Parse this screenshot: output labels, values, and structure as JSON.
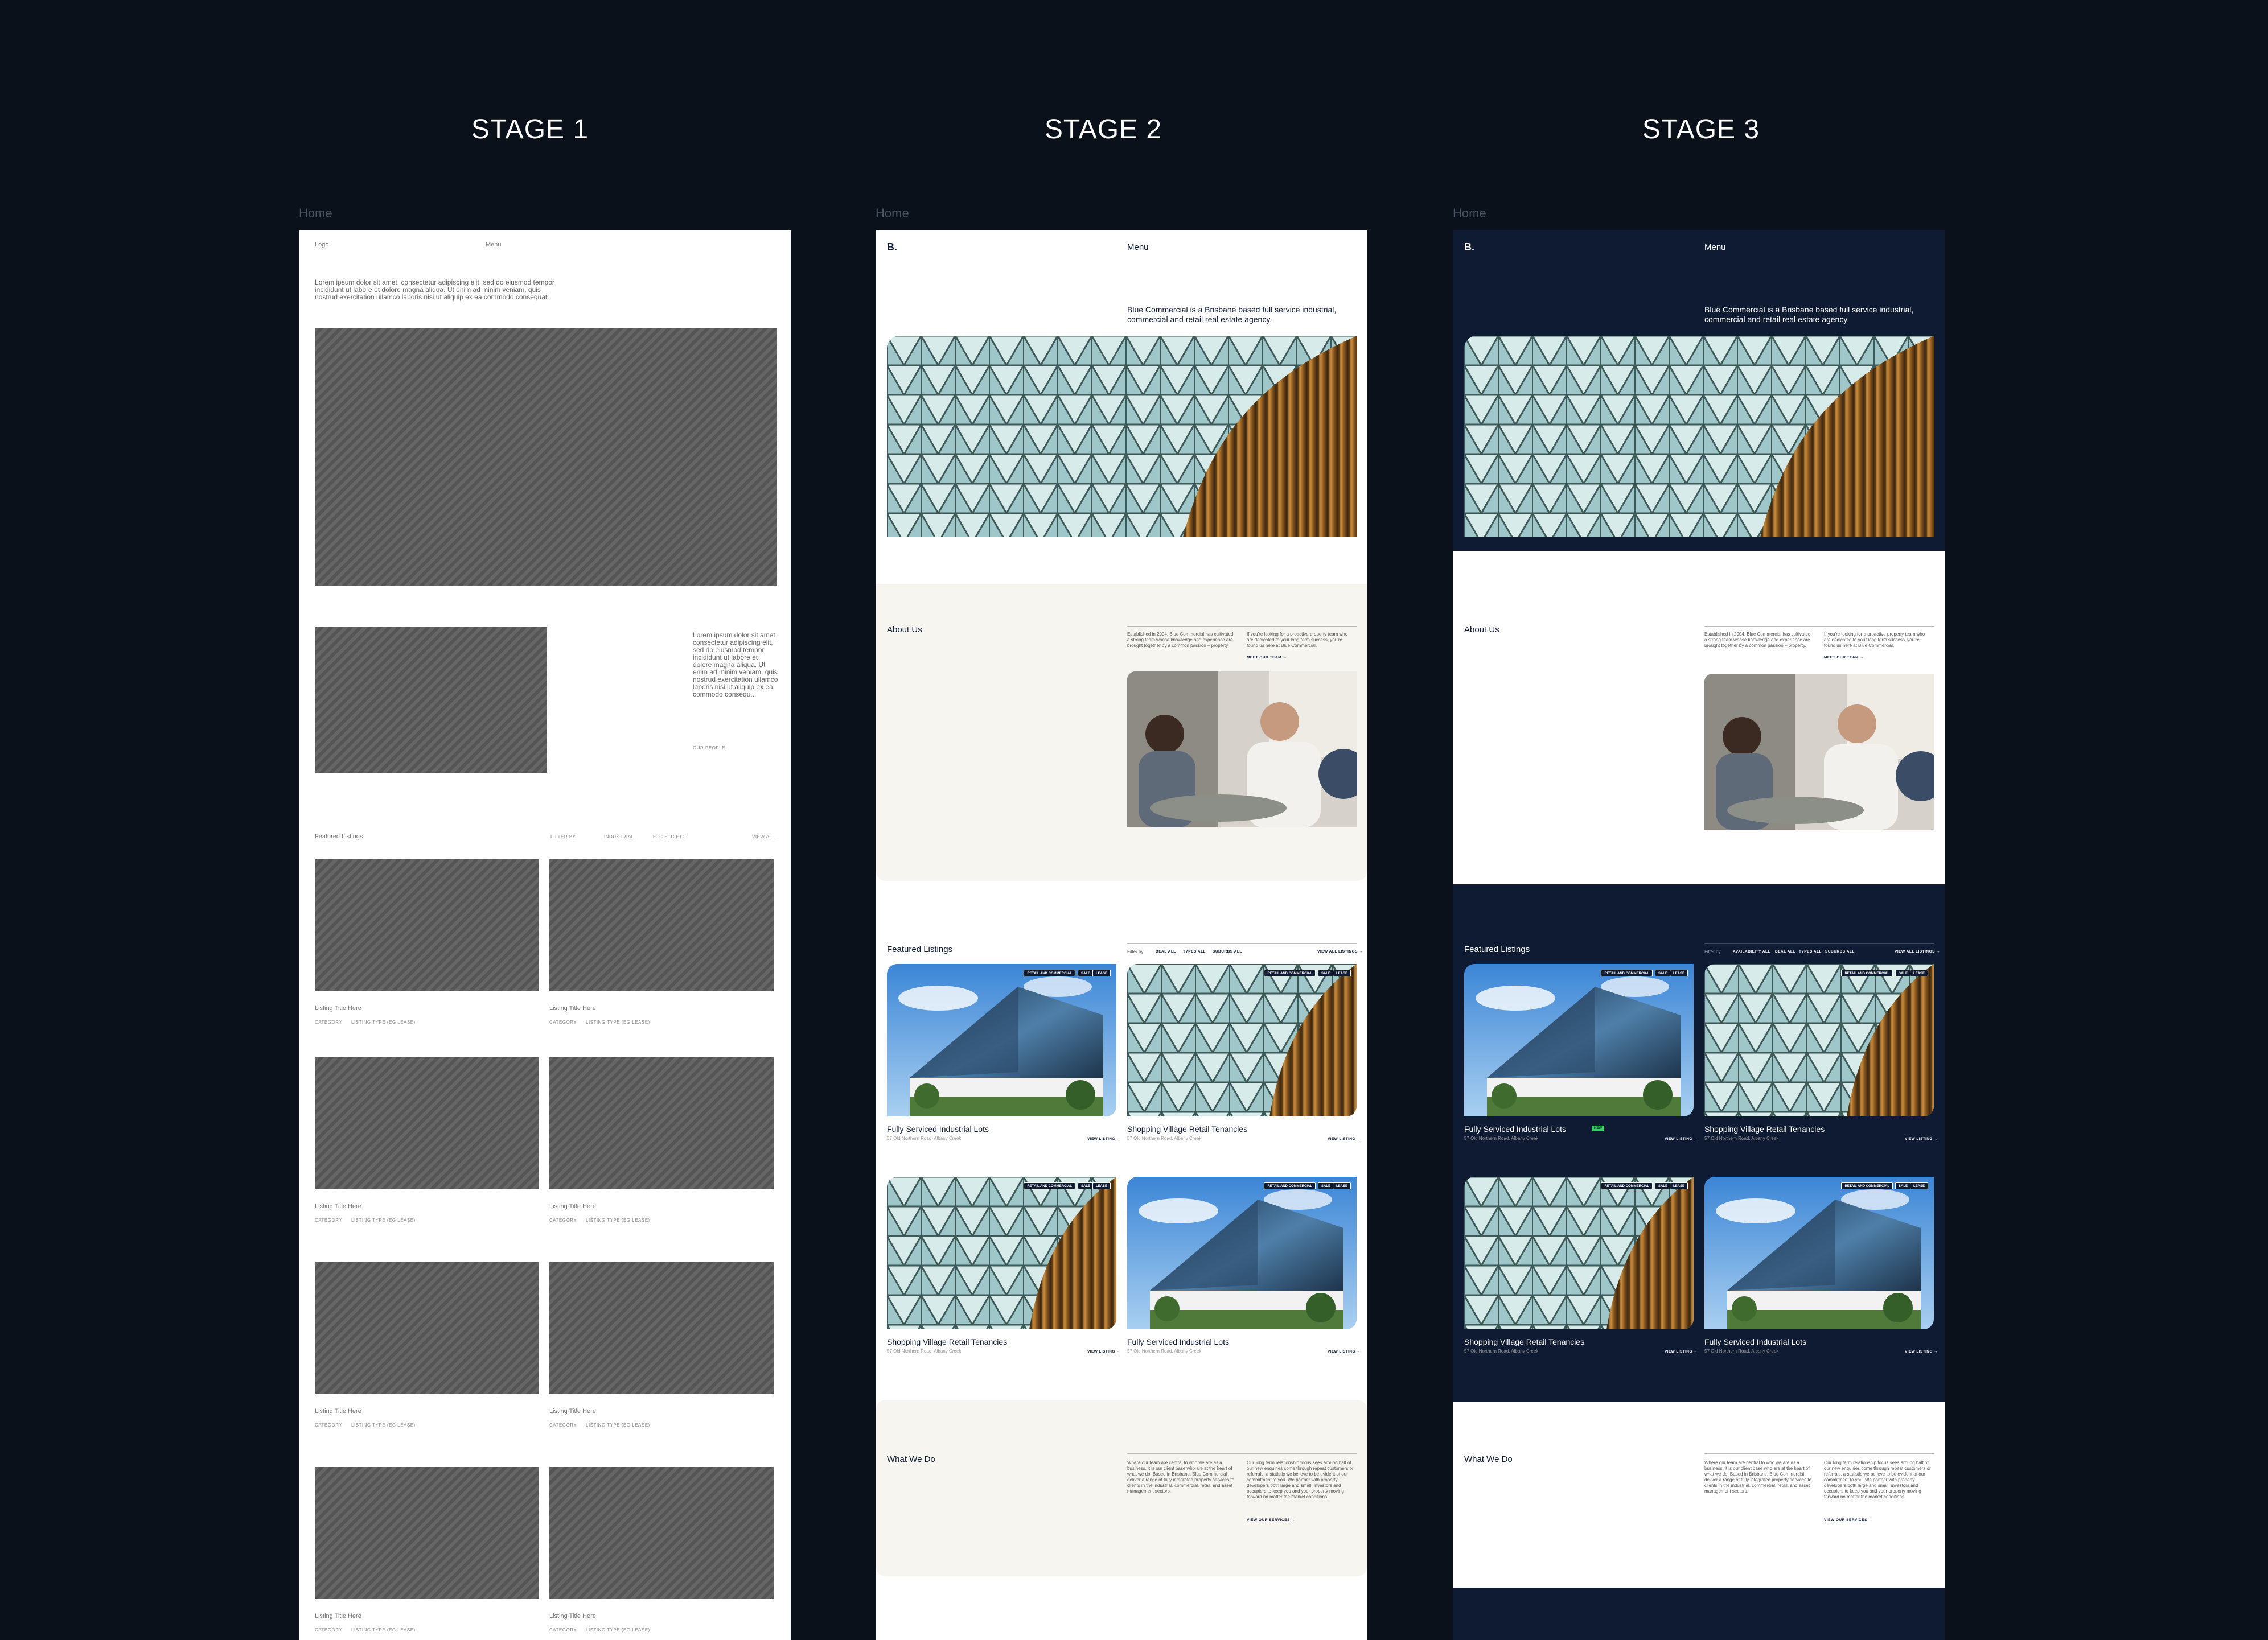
{
  "stages": {
    "s1": "STAGE 1",
    "s2": "STAGE 2",
    "s3": "STAGE 3"
  },
  "page_label": "Home",
  "wireframe": {
    "logo": "Logo",
    "menu": "Menu",
    "intro": "Lorem ipsum dolor sit amet, consectetur adipiscing elit, sed do eiusmod tempor incididunt ut labore et dolore magna aliqua. Ut enim ad minim veniam, quis nostrud exercitation ullamco laboris nisi ut aliquip ex ea commodo consequat.",
    "about_text": "Lorem ipsum dolor sit amet, consectetur adipiscing elit, sed do eiusmod tempor incididunt ut labore et dolore magna aliqua. Ut enim ad minim veniam, quis nostrud exercitation ullamco laboris nisi ut aliquip ex ea commodo consequ...",
    "our_people": "OUR PEOPLE",
    "featured": "Featured Listings",
    "filter_by": "FILTER BY",
    "industrial": "INDUSTRIAL",
    "etc": "ETC ETC ETC",
    "view_all": "VIEW ALL",
    "listing_title": "Listing Title Here",
    "category": "CATEGORY",
    "listing_type": "LISTING TYPE (EG LEASE)"
  },
  "site": {
    "logo": "B.",
    "menu": "Menu",
    "tagline": "Blue Commercial is a Brisbane based full service industrial, commercial and retail real estate agency.",
    "about_heading": "About Us",
    "about_col1": "Established in 2004, Blue Commercial has cultivated a strong team whose knowledge and experience are brought together by a common passion – property.",
    "about_col2": "If you're looking for a proactive property team who are dedicated to your long term success, you're found us here at Blue Commercial.",
    "meet_team": "MEET OUR TEAM →",
    "featured_heading": "Featured Listings",
    "filter_by": "Filter by",
    "filter_avail": "AVAILABILITY ALL",
    "filter_deal": "DEAL ALL",
    "filter_types": "TYPES ALL",
    "filter_suburbs": "SUBURBS ALL",
    "view_all_listings": "VIEW ALL LISTINGS →",
    "badge_retail": "RETAIL AND COMMERCIAL",
    "badge_sale": "SALE",
    "badge_lease": "LEASE",
    "listing_a_title": "Fully Serviced Industrial Lots",
    "listing_b_title": "Shopping Village Retail Tenancies",
    "address": "57 Old Northern Road, Albany Creek",
    "view_listing": "VIEW LISTING →",
    "what_heading": "What We Do",
    "what_col1": "Where our team are central to who we are as a business, it is our client base who are at the heart of what we do. Based in Brisbane, Blue Commercial deliver a range of fully integrated property services to clients in the industrial, commercial, retail, and asset management sectors.",
    "what_col2": "Our long term relationship focus sees around half of our new enquiries come through repeat customers or referrals, a statistic we believe to be evident of our commitment to you. We partner with property developers both large and small, investors and occupiers to keep you and your property moving forward no matter the market conditions.",
    "view_services": "VIEW OUR SERVICES →",
    "new_badge": "NEW"
  },
  "colors": {
    "background": "#0a111b",
    "navy": "#0e1b33",
    "cream": "#f7f5f0",
    "accent_green": "#3fcf6a"
  }
}
